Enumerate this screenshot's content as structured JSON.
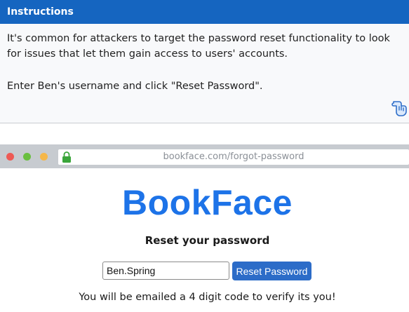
{
  "instructions": {
    "title": "Instructions",
    "paragraph1": "It's common for attackers to target the password reset functionality to look for issues that let them gain access to users' accounts.",
    "paragraph2": "Enter Ben's username and click \"Reset Password\".",
    "hint_icon": "pointing-hand-icon"
  },
  "browser": {
    "url": "bookface.com/forgot-password",
    "lock_icon": "lock-icon",
    "colors": {
      "close": "#ee5a55",
      "minimize": "#6abf40",
      "maximize": "#f5b74a"
    }
  },
  "page": {
    "logo": "BookFace",
    "subtitle": "Reset your password",
    "username_value": "Ben.Spring",
    "button_label": "Reset Password",
    "note": "You will be emailed a 4 digit code to verify its you!",
    "colors": {
      "header": "#1565c0",
      "logo": "#1d73e8",
      "button": "#2c6cc8"
    }
  }
}
